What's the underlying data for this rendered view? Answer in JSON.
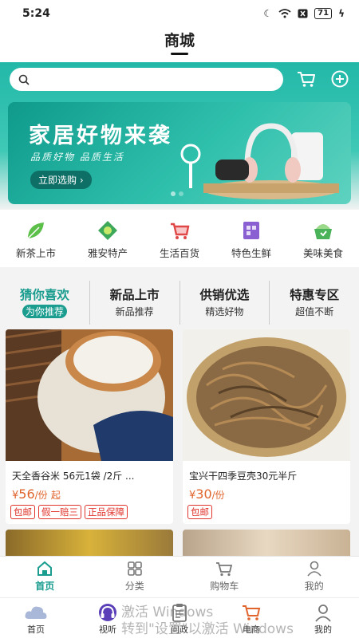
{
  "status_bar": {
    "time": "5:24",
    "battery": "71"
  },
  "header": {
    "title": "商城"
  },
  "search": {
    "placeholder": ""
  },
  "banner": {
    "title": "家居好物来袭",
    "subtitle": "品质好物  品质生活",
    "cta": "立即选购"
  },
  "categories": [
    {
      "label": "新茶上市",
      "icon": "tea-leaf-icon"
    },
    {
      "label": "雅安特产",
      "icon": "specialty-icon"
    },
    {
      "label": "生活百货",
      "icon": "shopping-cart-icon"
    },
    {
      "label": "特色生鲜",
      "icon": "fresh-food-icon"
    },
    {
      "label": "美味美食",
      "icon": "food-icon"
    }
  ],
  "tabs": [
    {
      "title": "猜你喜欢",
      "sub": "为你推荐"
    },
    {
      "title": "新品上市",
      "sub": "新品推荐"
    },
    {
      "title": "供销优选",
      "sub": "精选好物"
    },
    {
      "title": "特惠专区",
      "sub": "超值不断"
    }
  ],
  "products": [
    {
      "name": "天全香谷米 56元1袋 /2斤 ...",
      "currency": "¥",
      "price": "56",
      "unit": "/份",
      "suffix": "起",
      "tags": [
        "包邮",
        "假一赔三",
        "正品保障"
      ]
    },
    {
      "name": "宝兴干四季豆壳30元半斤",
      "currency": "¥",
      "price": "30",
      "unit": "/份",
      "suffix": "",
      "tags": [
        "包邮"
      ]
    }
  ],
  "bottom_nav": [
    {
      "label": "首页",
      "icon": "home-icon"
    },
    {
      "label": "分类",
      "icon": "grid-icon"
    },
    {
      "label": "购物车",
      "icon": "cart-icon"
    },
    {
      "label": "我的",
      "icon": "user-icon"
    }
  ],
  "system_nav": [
    {
      "label": "首页",
      "icon": "cloud-icon"
    },
    {
      "label": "视听",
      "icon": "headphone-icon"
    },
    {
      "label": "问政",
      "icon": "clipboard-icon"
    },
    {
      "label": "电商",
      "icon": "cart-icon"
    },
    {
      "label": "我的",
      "icon": "user-icon"
    }
  ],
  "watermark": {
    "line1": "激活 Windows",
    "line2": "转到\"设置\"以激活 Windows"
  },
  "colors": {
    "accent": "#1a9d8f",
    "price": "#e0642c",
    "tag": "#e0342c"
  }
}
